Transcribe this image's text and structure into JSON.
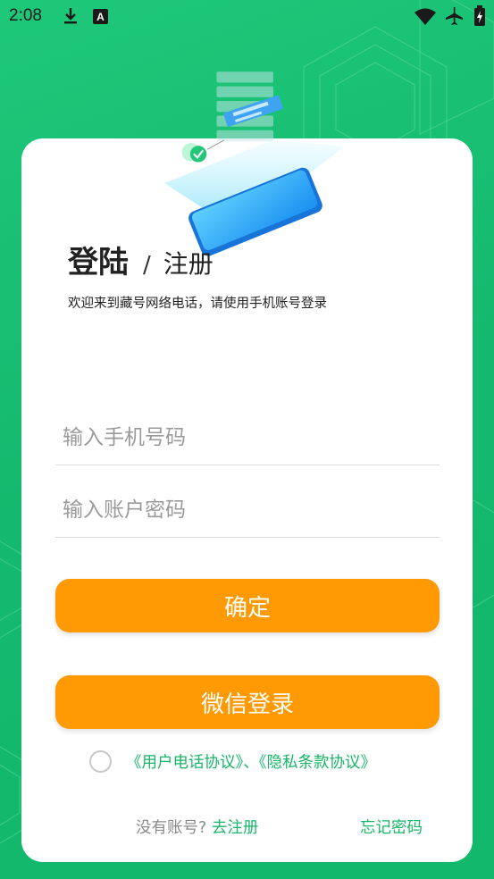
{
  "status_bar": {
    "time": "2:08",
    "icons": [
      "download-icon",
      "a-badge-icon",
      "wifi-icon",
      "airplane-icon",
      "battery-icon"
    ]
  },
  "login": {
    "title_login": "登陆",
    "separator": "/",
    "title_register": "注册",
    "welcome": "欢迎来到藏号网络电话，请使用手机账号登录",
    "phone_placeholder": "输入手机号码",
    "password_placeholder": "输入账户密码",
    "confirm_label": "确定",
    "wechat_label": "微信登录",
    "agreement_text": "《用户电话协议》、《隐私条款协议》",
    "no_account": "没有账号?",
    "go_register": "去注册",
    "forgot_password": "忘记密码"
  },
  "colors": {
    "background": "#14b86e",
    "accent_orange": "#ff9a05",
    "accent_green": "#17b568"
  }
}
